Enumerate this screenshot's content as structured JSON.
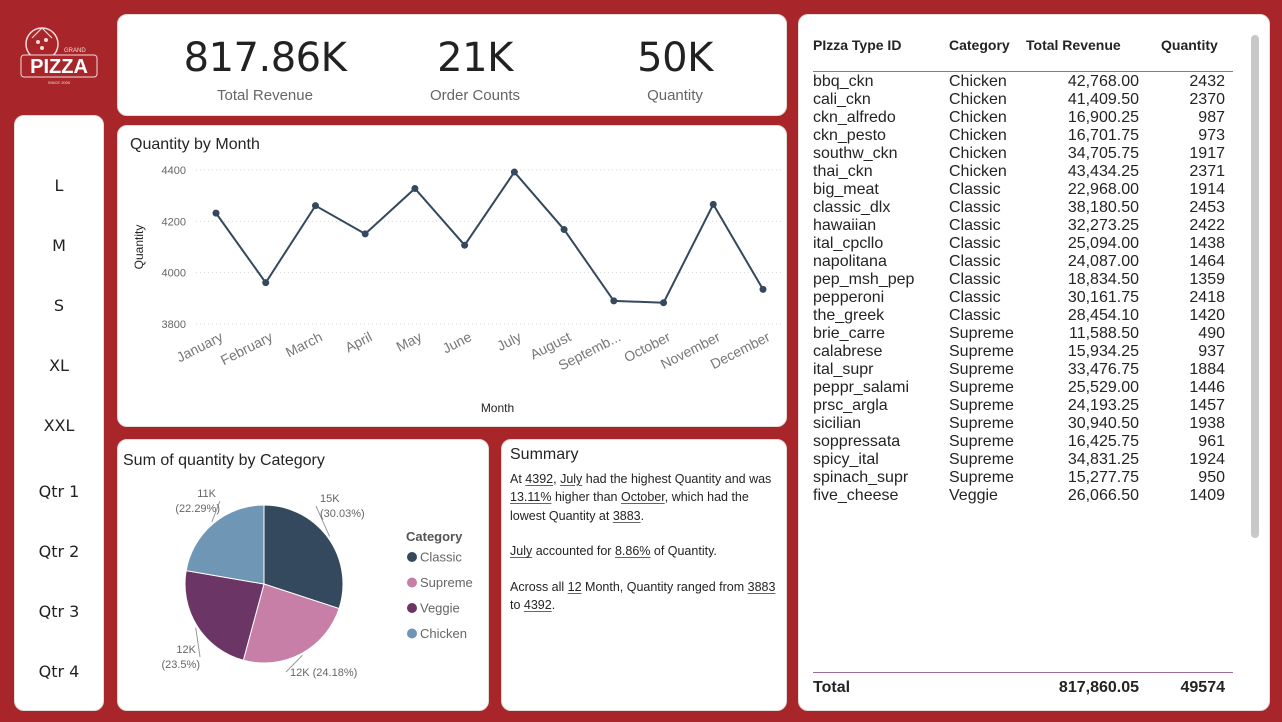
{
  "brand": {
    "logo_text": "PIZZA",
    "logo_sub": "GRAND",
    "logo_since": "SINCE 2000"
  },
  "kpis": [
    {
      "value": "817.86K",
      "label": "Total Revenue"
    },
    {
      "value": "21K",
      "label": "Order Counts"
    },
    {
      "value": "50K",
      "label": "Quantity"
    }
  ],
  "slicer": {
    "items": [
      "L",
      "M",
      "S",
      "XL",
      "XXL",
      "Qtr 1",
      "Qtr 2",
      "Qtr 3",
      "Qtr 4"
    ]
  },
  "line_chart": {
    "title": "Quantity by Month",
    "chart_data": {
      "type": "line",
      "title": "Quantity by Month",
      "xlabel": "Month",
      "ylabel": "Quantity",
      "categories": [
        "January",
        "February",
        "March",
        "April",
        "May",
        "June",
        "July",
        "August",
        "Septemb...",
        "October",
        "November",
        "December"
      ],
      "values": [
        4232,
        3961,
        4261,
        4151,
        4328,
        4107,
        4392,
        4168,
        3890,
        3883,
        4266,
        3935
      ],
      "yticks": [
        3800,
        4000,
        4200,
        4400
      ],
      "ylim": [
        3800,
        4400
      ],
      "grid": true,
      "color": "#34495e"
    }
  },
  "pie_chart": {
    "title": "Sum of quantity by Category",
    "legend_title": "Category",
    "chart_data": {
      "type": "pie",
      "title": "Sum of quantity by Category",
      "labels": [
        "Classic",
        "Supreme",
        "Veggie",
        "Chicken"
      ],
      "values": [
        14888,
        11987,
        11649,
        11050
      ],
      "percent": [
        30.03,
        24.18,
        23.5,
        22.29
      ],
      "colors": [
        "#34495e",
        "#c77fa8",
        "#6b3566",
        "#6f97b5"
      ],
      "legend": "right"
    },
    "slice_labels": [
      {
        "a": "15K",
        "b": "(30.03%)"
      },
      {
        "a": "12K (24.18%)",
        "b": ""
      },
      {
        "a": "12K",
        "b": "(23.5%)"
      },
      {
        "a": "11K",
        "b": "(22.29%)"
      }
    ]
  },
  "summary": {
    "title": "Summary",
    "p1_a": "At ",
    "p1_v1": "4392",
    "p1_b": ", ",
    "p1_v2": "July",
    "p1_c": " had the highest Quantity and was ",
    "p1_v3": "13.11%",
    "p1_d": " higher than ",
    "p1_v4": "October",
    "p1_e": ", which had the lowest Quantity at ",
    "p1_v5": "3883",
    "p1_f": ".",
    "p2_v1": "July",
    "p2_a": " accounted for ",
    "p2_v2": "8.86%",
    "p2_b": " of Quantity.",
    "p3_a": "Across all ",
    "p3_v1": "12",
    "p3_b": " Month, Quantity ranged from ",
    "p3_v2": "3883",
    "p3_c": " to ",
    "p3_v3": "4392",
    "p3_d": "."
  },
  "table": {
    "headers": [
      "PIzza Type ID",
      "Category",
      "Total Revenue",
      "Quantity"
    ],
    "rows": [
      [
        "bbq_ckn",
        "Chicken",
        "42,768.00",
        "2432"
      ],
      [
        "cali_ckn",
        "Chicken",
        "41,409.50",
        "2370"
      ],
      [
        "ckn_alfredo",
        "Chicken",
        "16,900.25",
        "987"
      ],
      [
        "ckn_pesto",
        "Chicken",
        "16,701.75",
        "973"
      ],
      [
        "southw_ckn",
        "Chicken",
        "34,705.75",
        "1917"
      ],
      [
        "thai_ckn",
        "Chicken",
        "43,434.25",
        "2371"
      ],
      [
        "big_meat",
        "Classic",
        "22,968.00",
        "1914"
      ],
      [
        "classic_dlx",
        "Classic",
        "38,180.50",
        "2453"
      ],
      [
        "hawaiian",
        "Classic",
        "32,273.25",
        "2422"
      ],
      [
        "ital_cpcllo",
        "Classic",
        "25,094.00",
        "1438"
      ],
      [
        "napolitana",
        "Classic",
        "24,087.00",
        "1464"
      ],
      [
        "pep_msh_pep",
        "Classic",
        "18,834.50",
        "1359"
      ],
      [
        "pepperoni",
        "Classic",
        "30,161.75",
        "2418"
      ],
      [
        "the_greek",
        "Classic",
        "28,454.10",
        "1420"
      ],
      [
        "brie_carre",
        "Supreme",
        "11,588.50",
        "490"
      ],
      [
        "calabrese",
        "Supreme",
        "15,934.25",
        "937"
      ],
      [
        "ital_supr",
        "Supreme",
        "33,476.75",
        "1884"
      ],
      [
        "peppr_salami",
        "Supreme",
        "25,529.00",
        "1446"
      ],
      [
        "prsc_argla",
        "Supreme",
        "24,193.25",
        "1457"
      ],
      [
        "sicilian",
        "Supreme",
        "30,940.50",
        "1938"
      ],
      [
        "soppressata",
        "Supreme",
        "16,425.75",
        "961"
      ],
      [
        "spicy_ital",
        "Supreme",
        "34,831.25",
        "1924"
      ],
      [
        "spinach_supr",
        "Supreme",
        "15,277.75",
        "950"
      ],
      [
        "five_cheese",
        "Veggie",
        "26,066.50",
        "1409"
      ]
    ],
    "total": {
      "label": "Total",
      "revenue": "817,860.05",
      "quantity": "49574"
    }
  }
}
